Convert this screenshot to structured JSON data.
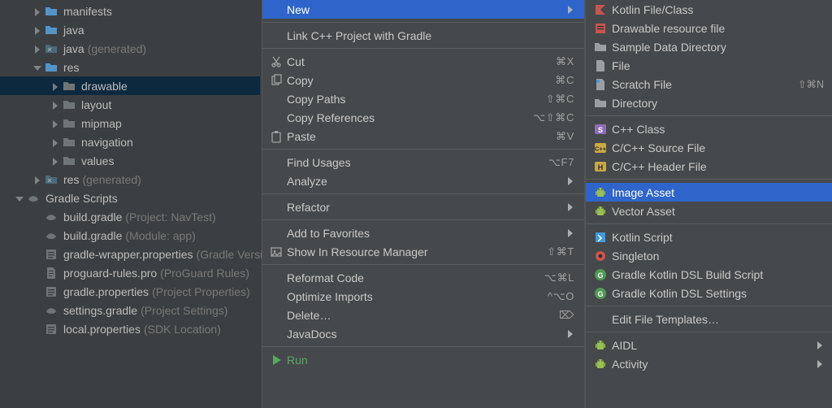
{
  "tree": {
    "items": [
      {
        "depth": 1,
        "arrow": "right",
        "icon": "folder-blue",
        "label": "manifests"
      },
      {
        "depth": 1,
        "arrow": "right",
        "icon": "folder-blue",
        "label": "java"
      },
      {
        "depth": 1,
        "arrow": "right",
        "icon": "folder-gen",
        "label": "java",
        "hint": "(generated)",
        "dimHint": true
      },
      {
        "depth": 1,
        "arrow": "down",
        "icon": "folder-res",
        "label": "res"
      },
      {
        "depth": 2,
        "arrow": "right",
        "icon": "folder-dark",
        "label": "drawable",
        "selected": true
      },
      {
        "depth": 2,
        "arrow": "right",
        "icon": "folder-dark",
        "label": "layout"
      },
      {
        "depth": 2,
        "arrow": "right",
        "icon": "folder-dark",
        "label": "mipmap"
      },
      {
        "depth": 2,
        "arrow": "right",
        "icon": "folder-dark",
        "label": "navigation"
      },
      {
        "depth": 2,
        "arrow": "right",
        "icon": "folder-dark",
        "label": "values"
      },
      {
        "depth": 1,
        "arrow": "right",
        "icon": "folder-gen",
        "label": "res",
        "hint": "(generated)",
        "dimHint": true
      },
      {
        "depth": 0,
        "arrow": "down",
        "icon": "gradle",
        "label": "Gradle Scripts"
      },
      {
        "depth": 1,
        "arrow": "none",
        "icon": "gradle",
        "label": "build.gradle",
        "hint": "(Project: NavTest)",
        "dimHint": true
      },
      {
        "depth": 1,
        "arrow": "none",
        "icon": "gradle",
        "label": "build.gradle",
        "hint": "(Module: app)",
        "dimHint": true
      },
      {
        "depth": 1,
        "arrow": "none",
        "icon": "props",
        "label": "gradle-wrapper.properties",
        "hint": "(Gradle Version)",
        "dimHint": true,
        "clip": true
      },
      {
        "depth": 1,
        "arrow": "none",
        "icon": "file-text",
        "label": "proguard-rules.pro",
        "hint": "(ProGuard Rules)",
        "dimHint": true,
        "clip": true
      },
      {
        "depth": 1,
        "arrow": "none",
        "icon": "props",
        "label": "gradle.properties",
        "hint": "(Project Properties)",
        "dimHint": true,
        "clip": true
      },
      {
        "depth": 1,
        "arrow": "none",
        "icon": "gradle",
        "label": "settings.gradle",
        "hint": "(Project Settings)",
        "dimHint": true,
        "clip": true
      },
      {
        "depth": 1,
        "arrow": "none",
        "icon": "props",
        "label": "local.properties",
        "hint": "(SDK Location)",
        "dimHint": true
      }
    ]
  },
  "ctx": {
    "groups": [
      [
        {
          "label": "New",
          "arrow": true,
          "selected": true
        }
      ],
      [
        {
          "label": "Link C++ Project with Gradle"
        }
      ],
      [
        {
          "icon": "cut",
          "label": "Cut",
          "shortcut": "⌘X"
        },
        {
          "icon": "copy",
          "label": "Copy",
          "shortcut": "⌘C"
        },
        {
          "label": "Copy Paths",
          "shortcut": "⇧⌘C"
        },
        {
          "label": "Copy References",
          "shortcut": "⌥⇧⌘C"
        },
        {
          "icon": "paste",
          "label": "Paste",
          "shortcut": "⌘V"
        }
      ],
      [
        {
          "label": "Find Usages",
          "shortcut": "⌥F7"
        },
        {
          "label": "Analyze",
          "arrow": true
        }
      ],
      [
        {
          "label": "Refactor",
          "arrow": true
        }
      ],
      [
        {
          "label": "Add to Favorites",
          "arrow": true
        },
        {
          "icon": "resmgr",
          "label": "Show In Resource Manager",
          "shortcut": "⇧⌘T"
        }
      ],
      [
        {
          "label": "Reformat Code",
          "shortcut": "⌥⌘L"
        },
        {
          "label": "Optimize Imports",
          "shortcut": "^⌥O"
        },
        {
          "label": "Delete…",
          "shortcut": "⌦"
        },
        {
          "label": "JavaDocs",
          "arrow": true
        }
      ],
      [
        {
          "icon": "run",
          "label": "Run",
          "green": true
        }
      ]
    ]
  },
  "submenu": {
    "groups": [
      [
        {
          "icon": "kotlin",
          "label": "Kotlin File/Class"
        },
        {
          "icon": "drawable",
          "label": "Drawable resource file"
        },
        {
          "icon": "folder",
          "label": "Sample Data Directory"
        },
        {
          "icon": "file",
          "label": "File"
        },
        {
          "icon": "file-b",
          "label": "Scratch File",
          "shortcut": "⇧⌘N"
        },
        {
          "icon": "folder",
          "label": "Directory"
        }
      ],
      [
        {
          "icon": "s-badge",
          "label": "C++ Class"
        },
        {
          "icon": "cpp-badge",
          "label": "C/C++ Source File"
        },
        {
          "icon": "h-badge",
          "label": "C/C++ Header File"
        }
      ],
      [
        {
          "icon": "android",
          "label": "Image Asset",
          "selected": true
        },
        {
          "icon": "android",
          "label": "Vector Asset"
        }
      ],
      [
        {
          "icon": "kts",
          "label": "Kotlin Script"
        },
        {
          "icon": "singleton",
          "label": "Singleton"
        },
        {
          "icon": "g-badge",
          "label": "Gradle Kotlin DSL Build Script"
        },
        {
          "icon": "g-badge",
          "label": "Gradle Kotlin DSL Settings"
        }
      ],
      [
        {
          "label": "Edit File Templates…"
        }
      ],
      [
        {
          "icon": "android",
          "label": "AIDL",
          "arrow": true
        },
        {
          "icon": "android",
          "label": "Activity",
          "arrow": true
        }
      ]
    ]
  }
}
